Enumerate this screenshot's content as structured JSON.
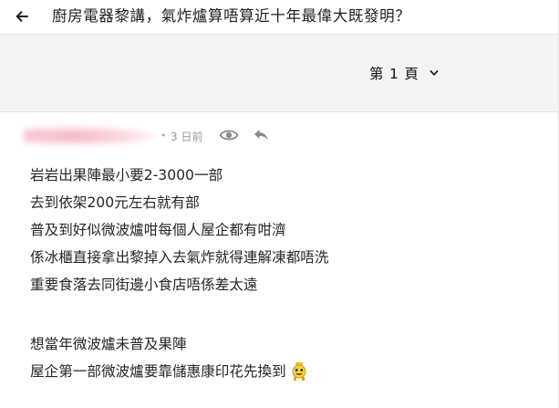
{
  "header": {
    "back_icon": "arrow-left-icon",
    "title": "廚房電器黎講，氣炸爐算唔算近十年最偉大既發明？"
  },
  "pagination": {
    "label": "第 1 頁",
    "dropdown_icon": "chevron-down-icon"
  },
  "post": {
    "username": "用戶",
    "separator": "•",
    "time": "3 日前",
    "view_icon": "eye-icon",
    "reply_icon": "reply-icon",
    "lines": [
      "岩岩出果陣最小要2-3000一部",
      "去到依架200元左右就有部",
      "普及到好似微波爐咁每個人屋企都有咁濟",
      "係冰櫃直接拿出黎掉入去氣炸就得連解凍都唔洗",
      "重要食落去同街邊小食店唔係差太遠",
      "",
      "想當年微波爐未普及果陣",
      "屋企第一部微波爐要靠儲惠康印花先換到"
    ],
    "emoji_icon": "emoticon-icon"
  },
  "colors": {
    "page_bar_bg": "#f4f4f4",
    "meta_text": "#9a9a9a",
    "icon_gray": "#8a8a8a"
  }
}
